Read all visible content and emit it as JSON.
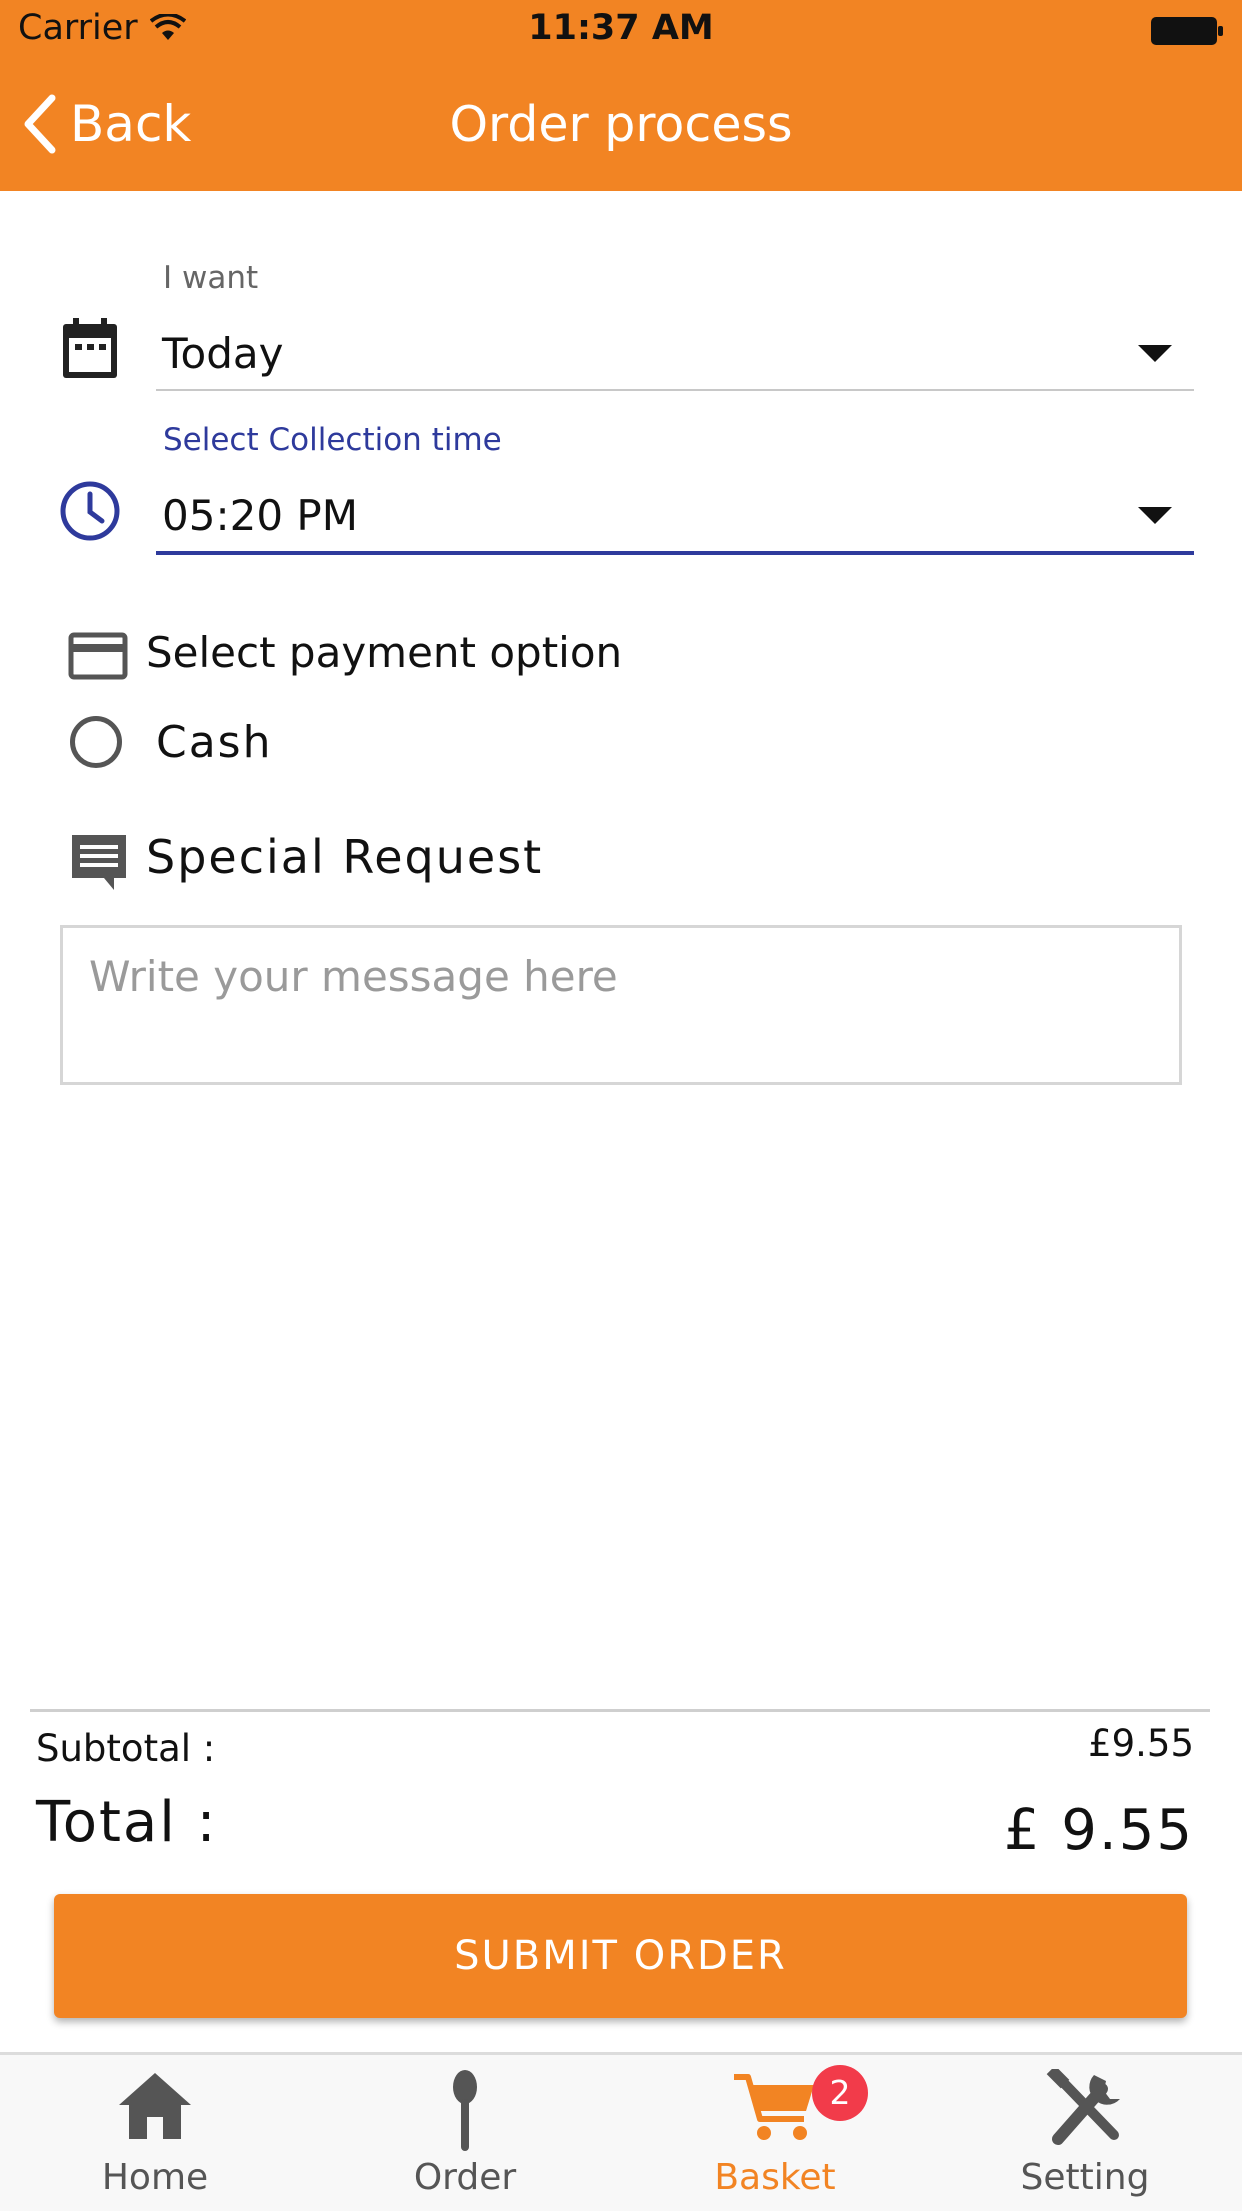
{
  "status_bar": {
    "carrier": "Carrier",
    "time": "11:37 AM"
  },
  "nav": {
    "back_label": "Back",
    "title": "Order process"
  },
  "form": {
    "when": {
      "label": "I want",
      "value": "Today"
    },
    "time": {
      "label": "Select Collection time",
      "value": "05:20 PM"
    },
    "payment": {
      "title": "Select payment option",
      "option": "Cash"
    },
    "special_request": {
      "title": "Special Request",
      "placeholder": "Write your message here",
      "value": ""
    }
  },
  "totals": {
    "subtotal_label": "Subtotal :",
    "subtotal_value": "£9.55",
    "total_label": "Total :",
    "total_value": "£ 9.55"
  },
  "submit_label": "SUBMIT ORDER",
  "tabs": [
    {
      "label": "Home",
      "icon": "home-icon"
    },
    {
      "label": "Order",
      "icon": "spoon-icon"
    },
    {
      "label": "Basket",
      "icon": "cart-icon",
      "badge": "2",
      "active": true
    },
    {
      "label": "Setting",
      "icon": "tools-icon"
    }
  ],
  "colors": {
    "accent": "#f28423",
    "focus": "#2e3a9c",
    "badge": "#f23b4a"
  }
}
